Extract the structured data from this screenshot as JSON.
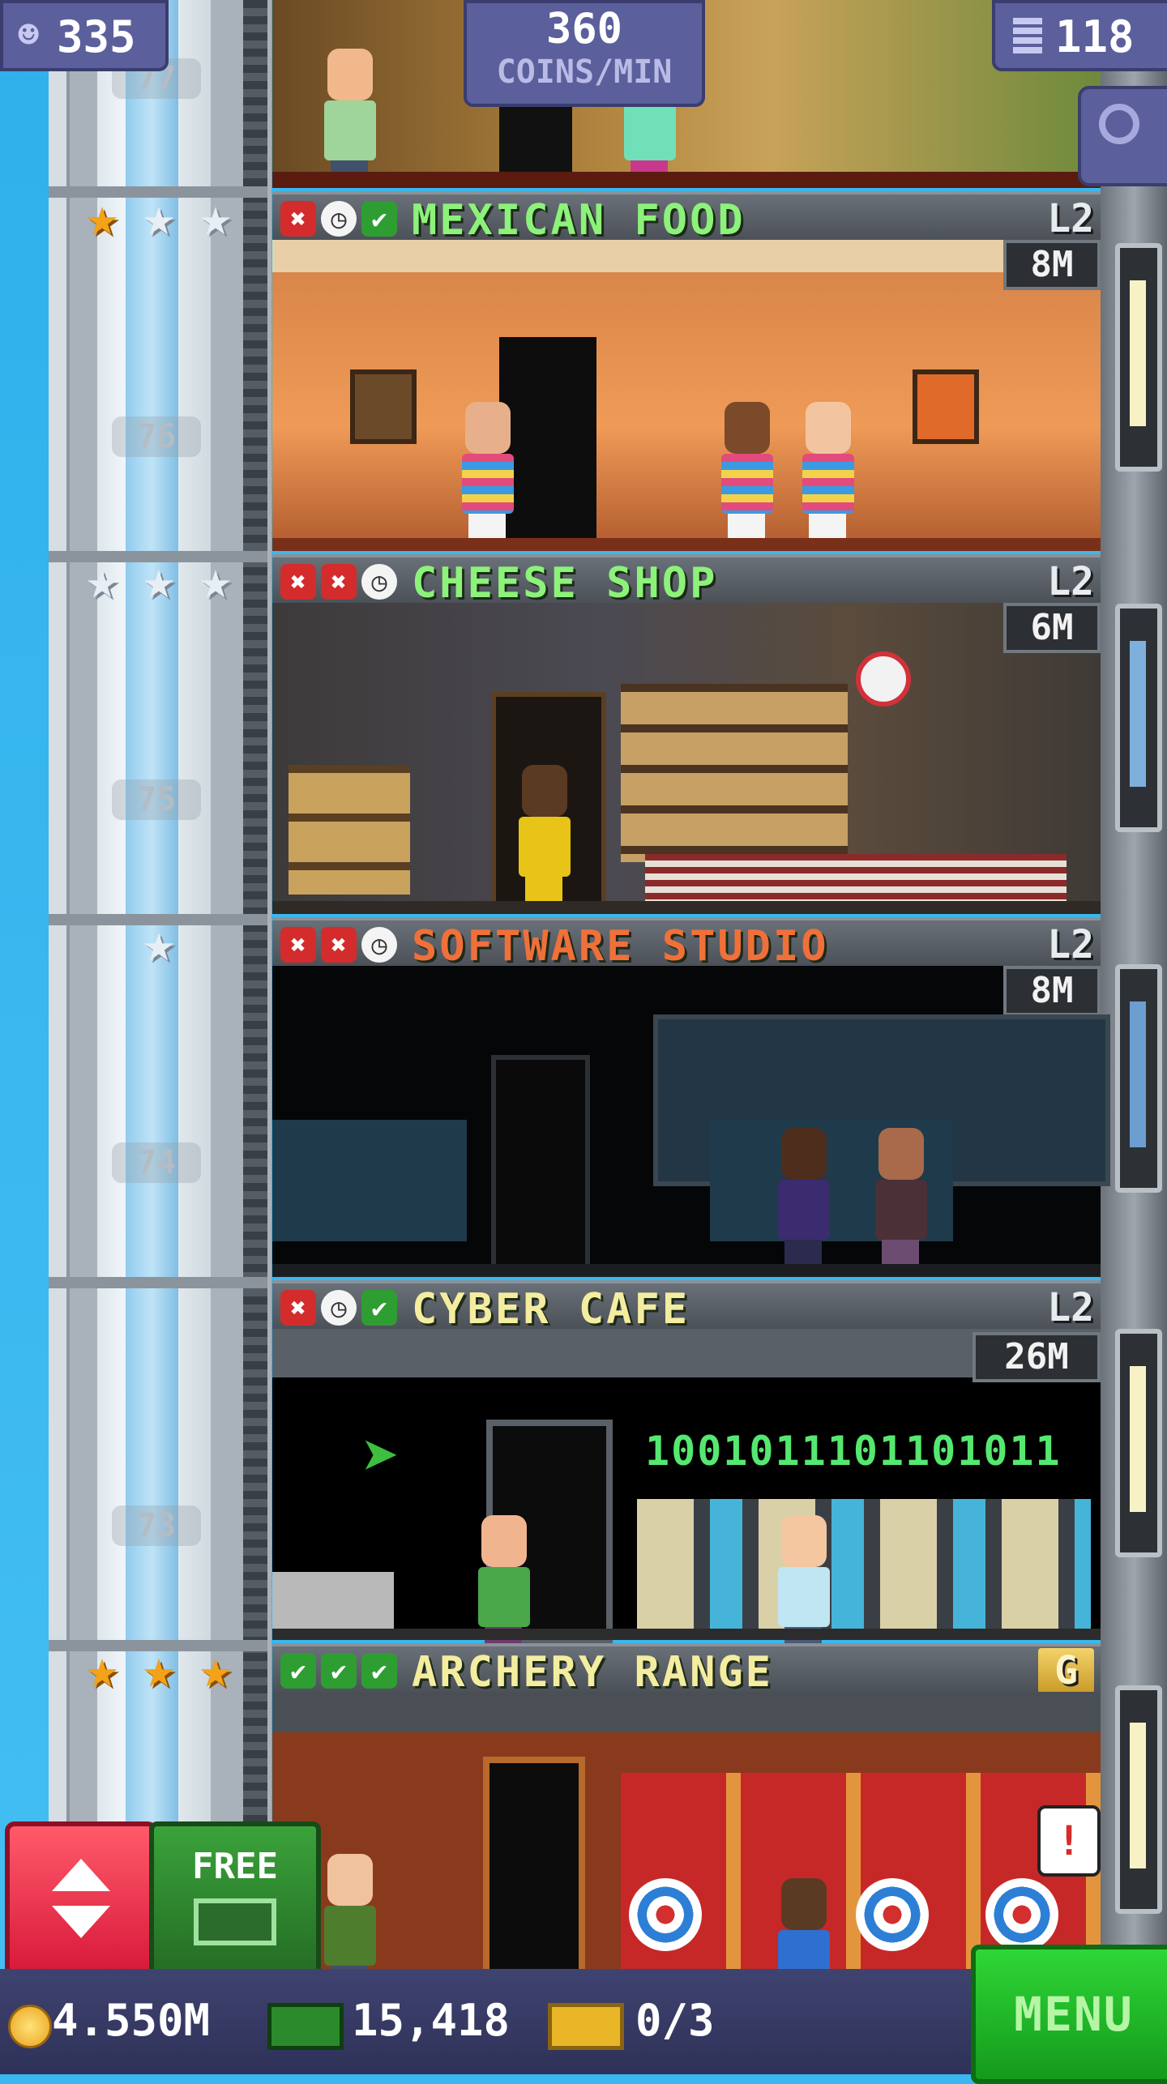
{
  "hud": {
    "population": "335",
    "coins_rate_value": "360",
    "coins_rate_unit": "COINS/MIN",
    "floor_count": "118"
  },
  "shaft_floor_numbers": [
    "77",
    "76",
    "75",
    "74",
    "73"
  ],
  "floors": [
    {
      "name": "MEXICAN FOOD",
      "level": "L2",
      "timer": "8M",
      "stars": [
        "gold",
        "silver",
        "silver"
      ],
      "status": [
        "x",
        "clock",
        "check"
      ],
      "title_color": "#8cf27a"
    },
    {
      "name": "CHEESE SHOP",
      "level": "L2",
      "timer": "6M",
      "stars": [
        "silver",
        "silver",
        "silver"
      ],
      "status": [
        "x",
        "x",
        "clock"
      ],
      "title_color": "#8cf27a"
    },
    {
      "name": "SOFTWARE STUDIO",
      "level": "L2",
      "timer": "8M",
      "stars": [
        "silver"
      ],
      "status": [
        "x",
        "x",
        "clock"
      ],
      "title_color": "#f0703a"
    },
    {
      "name": "CYBER CAFE",
      "level": "L2",
      "timer": "26M",
      "stars": [],
      "status": [
        "x",
        "clock",
        "check"
      ],
      "title_color": "#f4eda0"
    },
    {
      "name": "ARCHERY RANGE",
      "level": "G",
      "timer": "",
      "stars": [
        "gold",
        "gold",
        "gold"
      ],
      "status": [
        "check",
        "check",
        "check"
      ],
      "title_color": "#f4eda0"
    }
  ],
  "cyber_cafe_binary": "1001011101101011",
  "buttons": {
    "free_label": "FREE",
    "menu_label": "MENU"
  },
  "bottom": {
    "coins": "4.550M",
    "bux": "15,418",
    "tickets": "0/3"
  },
  "icons": [
    "person-icon",
    "floors-icon",
    "search-icon",
    "elevator-arrows-icon",
    "coin-icon",
    "bux-icon",
    "ticket-icon"
  ],
  "colors": {
    "menu_green": "#20c028",
    "elevator_red": "#e8283f",
    "hud_purple": "#5b5f9b"
  }
}
